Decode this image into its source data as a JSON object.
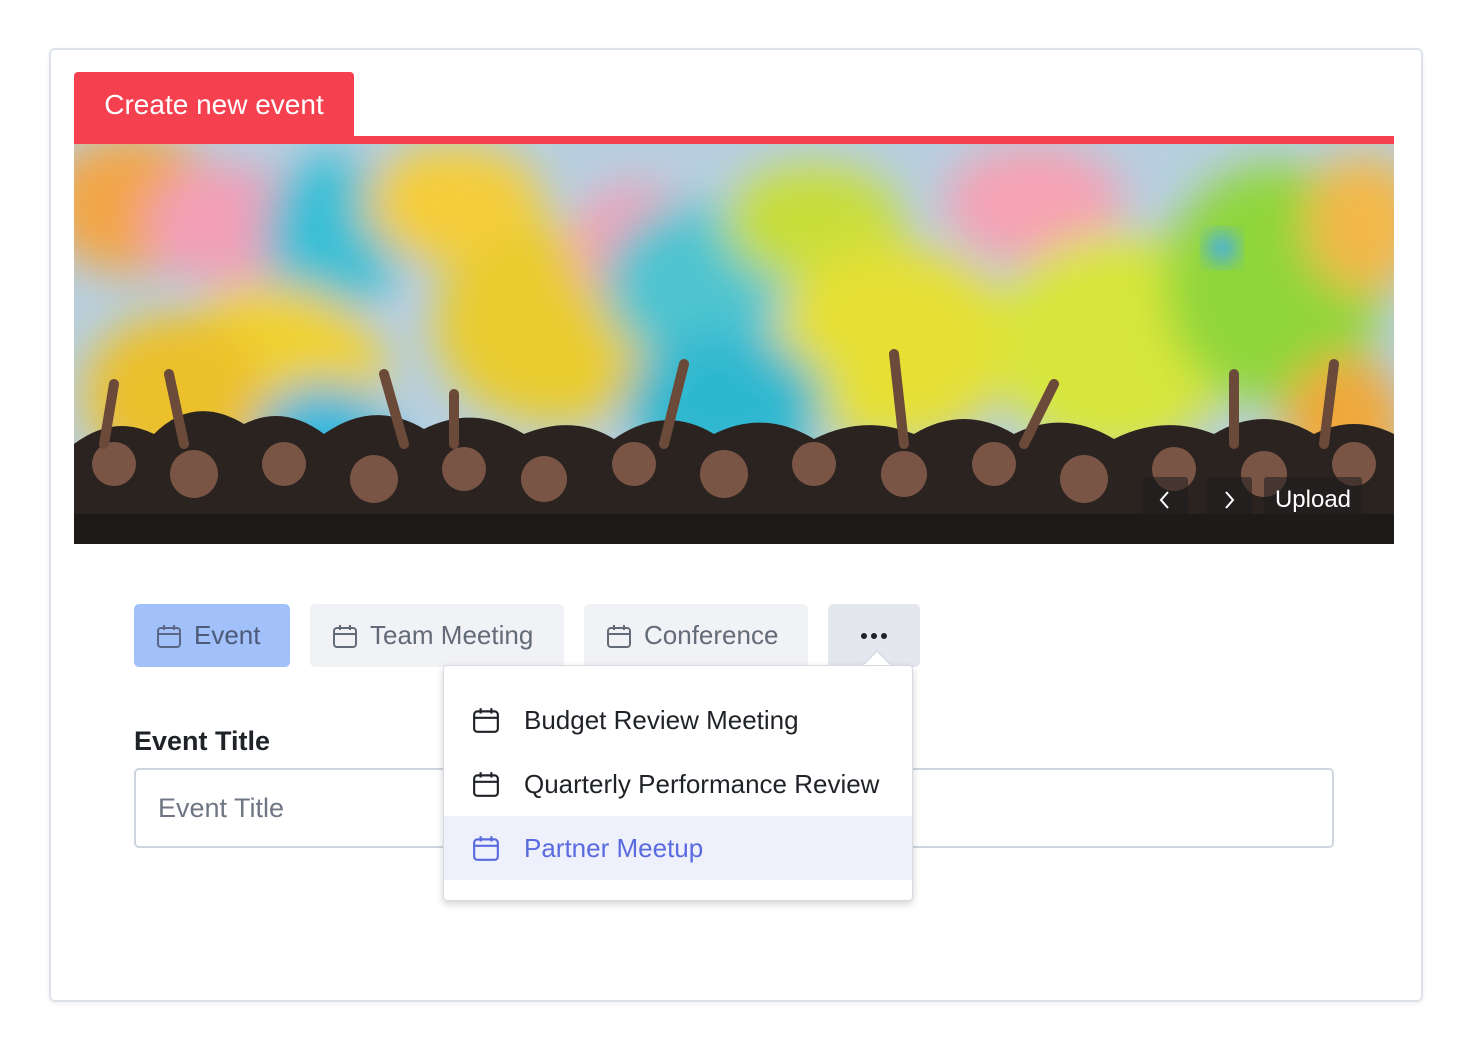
{
  "header": {
    "title": "Create new event"
  },
  "banner": {
    "image_alt": "Festival crowd throwing colored powder",
    "prev_icon": "chevron-left-icon",
    "next_icon": "chevron-right-icon",
    "upload_label": "Upload"
  },
  "event_types": [
    {
      "label": "Event",
      "icon": "calendar-icon",
      "active": true
    },
    {
      "label": "Team Meeting",
      "icon": "calendar-icon",
      "active": false
    },
    {
      "label": "Conference",
      "icon": "calendar-icon",
      "active": false
    }
  ],
  "more": {
    "icon": "more-horizontal-icon"
  },
  "dropdown": {
    "items": [
      {
        "label": "Budget Review Meeting",
        "icon": "calendar-icon",
        "selected": false
      },
      {
        "label": "Quarterly Performance Review",
        "icon": "calendar-icon",
        "selected": false
      },
      {
        "label": "Partner Meetup",
        "icon": "calendar-icon",
        "selected": true
      }
    ]
  },
  "form": {
    "title_label": "Event Title",
    "title_placeholder": "Event Title",
    "title_value": ""
  },
  "colors": {
    "accent": "#f5414f",
    "active_tab": "#a2c1fb",
    "selected_item_text": "#5a6be0",
    "selected_item_bg": "#eef0fb"
  }
}
